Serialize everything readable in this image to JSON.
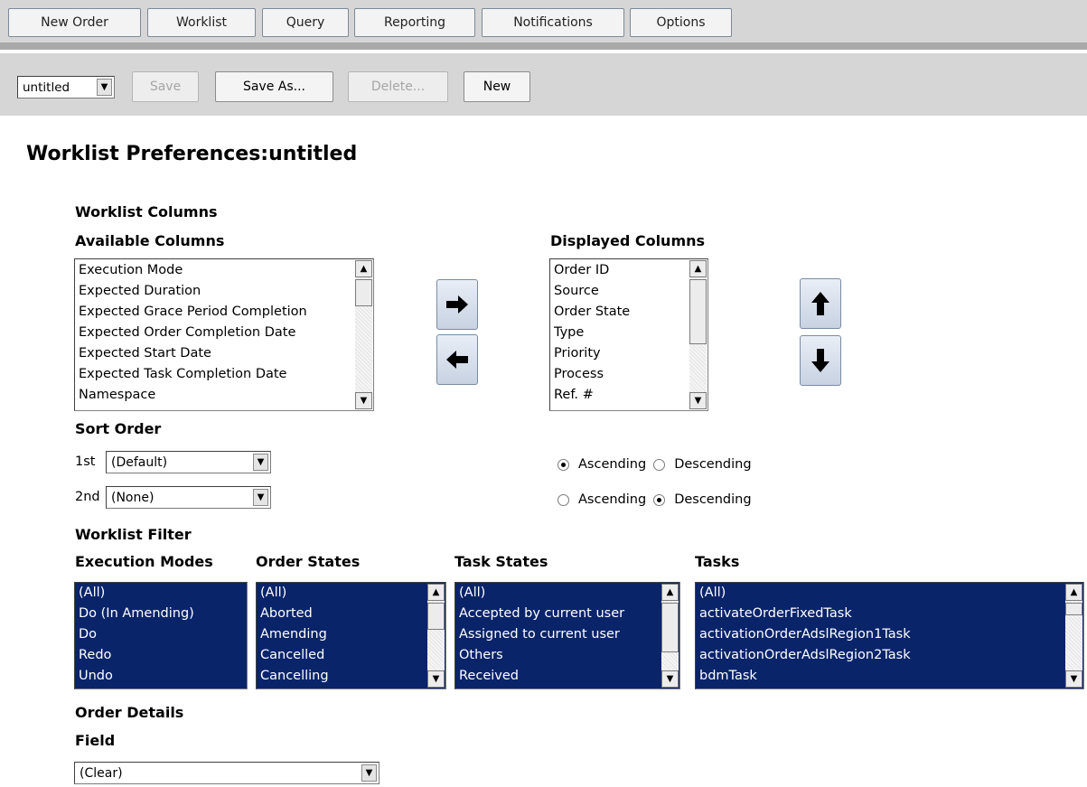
{
  "nav": {
    "tabs": [
      "New Order",
      "Worklist",
      "Query",
      "Reporting",
      "Notifications",
      "Options"
    ]
  },
  "toolbar": {
    "preference_select": "untitled",
    "save_label": "Save",
    "save_as_label": "Save As...",
    "delete_label": "Delete...",
    "new_label": "New"
  },
  "page": {
    "title": "Worklist Preferences:untitled"
  },
  "columns": {
    "heading": "Worklist Columns",
    "available_label": "Available Columns",
    "available": [
      "Execution Mode",
      "Expected Duration",
      "Expected Grace Period Completion",
      "Expected Order Completion Date",
      "Expected Start Date",
      "Expected Task Completion Date",
      "Namespace"
    ],
    "displayed_label": "Displayed Columns",
    "displayed": [
      "Order ID",
      "Source",
      "Order State",
      "Type",
      "Priority",
      "Process",
      "Ref. #"
    ]
  },
  "sort": {
    "heading": "Sort Order",
    "first_label": "1st",
    "first_value": "(Default)",
    "second_label": "2nd",
    "second_value": "(None)",
    "ascending_label": "Ascending",
    "descending_label": "Descending",
    "first_direction": "Ascending",
    "second_direction": "Descending"
  },
  "filter": {
    "heading": "Worklist Filter",
    "execution_modes_label": "Execution Modes",
    "execution_modes": [
      "(All)",
      "Do (In Amending)",
      "Do",
      "Redo",
      "Undo"
    ],
    "order_states_label": "Order States",
    "order_states": [
      "(All)",
      "Aborted",
      "Amending",
      "Cancelled",
      "Cancelling"
    ],
    "task_states_label": "Task States",
    "task_states": [
      "(All)",
      "Accepted by current user",
      "Assigned to current user",
      "Others",
      "Received"
    ],
    "tasks_label": "Tasks",
    "tasks": [
      "(All)",
      "activateOrderFixedTask",
      "activationOrderAdslRegion1Task",
      "activationOrderAdslRegion2Task",
      "bdmTask"
    ]
  },
  "details": {
    "heading": "Order Details",
    "field_label": "Field",
    "field_value": "(Clear)"
  }
}
